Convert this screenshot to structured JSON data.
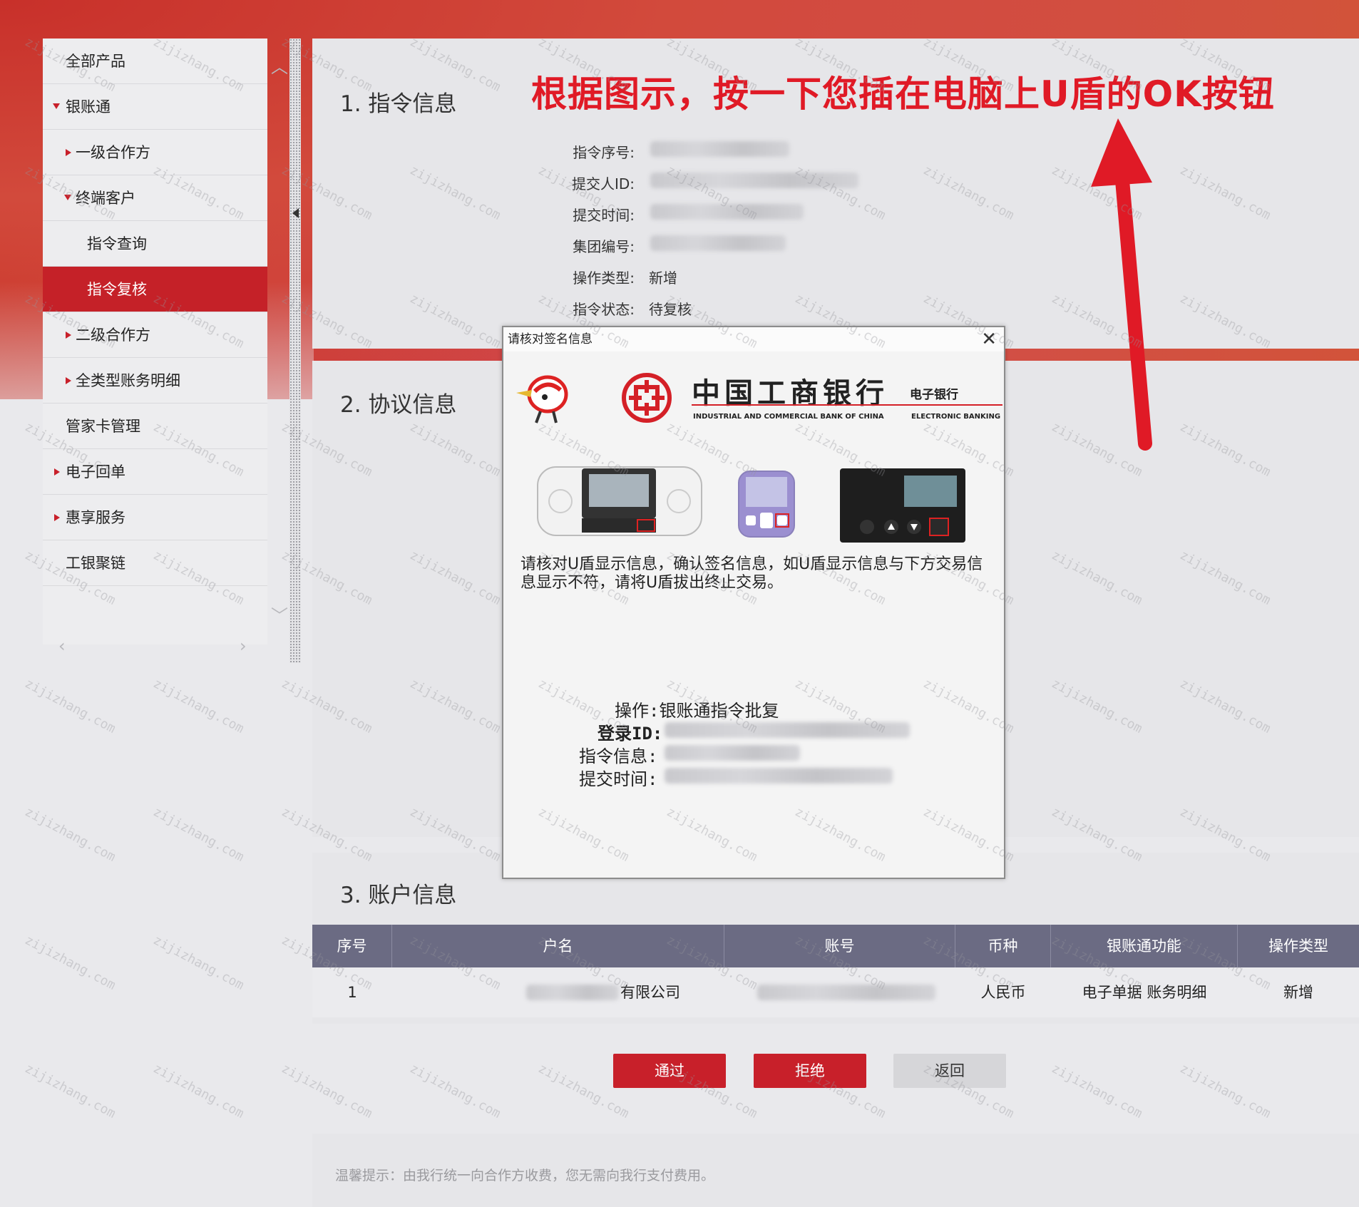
{
  "instruction": "根据图示，按一下您插在电脑上U盾的OK按钮",
  "sidebar": {
    "items": [
      {
        "label": "全部产品"
      },
      {
        "label": "银账通"
      },
      {
        "label": "一级合作方"
      },
      {
        "label": "终端客户"
      },
      {
        "label": "指令查询"
      },
      {
        "label": "指令复核"
      },
      {
        "label": "二级合作方"
      },
      {
        "label": "全类型账务明细"
      },
      {
        "label": "管家卡管理"
      },
      {
        "label": "电子回单"
      },
      {
        "label": "惠享服务"
      },
      {
        "label": "工银聚链"
      }
    ]
  },
  "section1": {
    "title": "1. 指令信息",
    "fields": [
      {
        "label": "指令序号:",
        "value": ""
      },
      {
        "label": "提交人ID:",
        "value": ""
      },
      {
        "label": "提交时间:",
        "value": ""
      },
      {
        "label": "集团编号:",
        "value": ""
      },
      {
        "label": "操作类型:",
        "value": "新增"
      },
      {
        "label": "指令状态:",
        "value": "待复核"
      }
    ]
  },
  "section2": {
    "title": "2. 协议信息"
  },
  "section3": {
    "title": "3. 账户信息",
    "columns": [
      "序号",
      "户名",
      "账号",
      "币种",
      "银账通功能",
      "操作类型"
    ],
    "rows": [
      {
        "index": "1",
        "name": "有限公司",
        "account": "",
        "currency": "人民币",
        "function": "电子单据 账务明细",
        "op_type": "新增"
      }
    ]
  },
  "buttons": {
    "approve": "通过",
    "reject": "拒绝",
    "back": "返回"
  },
  "tip": "温馨提示：由我行统一向合作方收费，您无需向我行支付费用。",
  "dialog": {
    "title": "请核对签名信息",
    "bank_name_cn": "中国工商银行",
    "bank_name_en": "INDUSTRIAL AND COMMERCIAL BANK OF CHINA",
    "ebank_cn": "电子银行",
    "ebank_en": "ELECTRONIC BANKING",
    "message": "请核对U盾显示信息，确认签名信息，如U盾显示信息与下方交易信息显示不符，请将U盾拔出终止交易。",
    "op_line": "操作:银账通指令批复",
    "login_label": "登录ID:",
    "instr_label": "指令信息:",
    "time_label": "提交时间:"
  },
  "watermark": "zijizhang.com",
  "colors": {
    "brand_red": "#c8202a",
    "table_header": "#6b6b83",
    "instruction_red": "#e01a26"
  }
}
